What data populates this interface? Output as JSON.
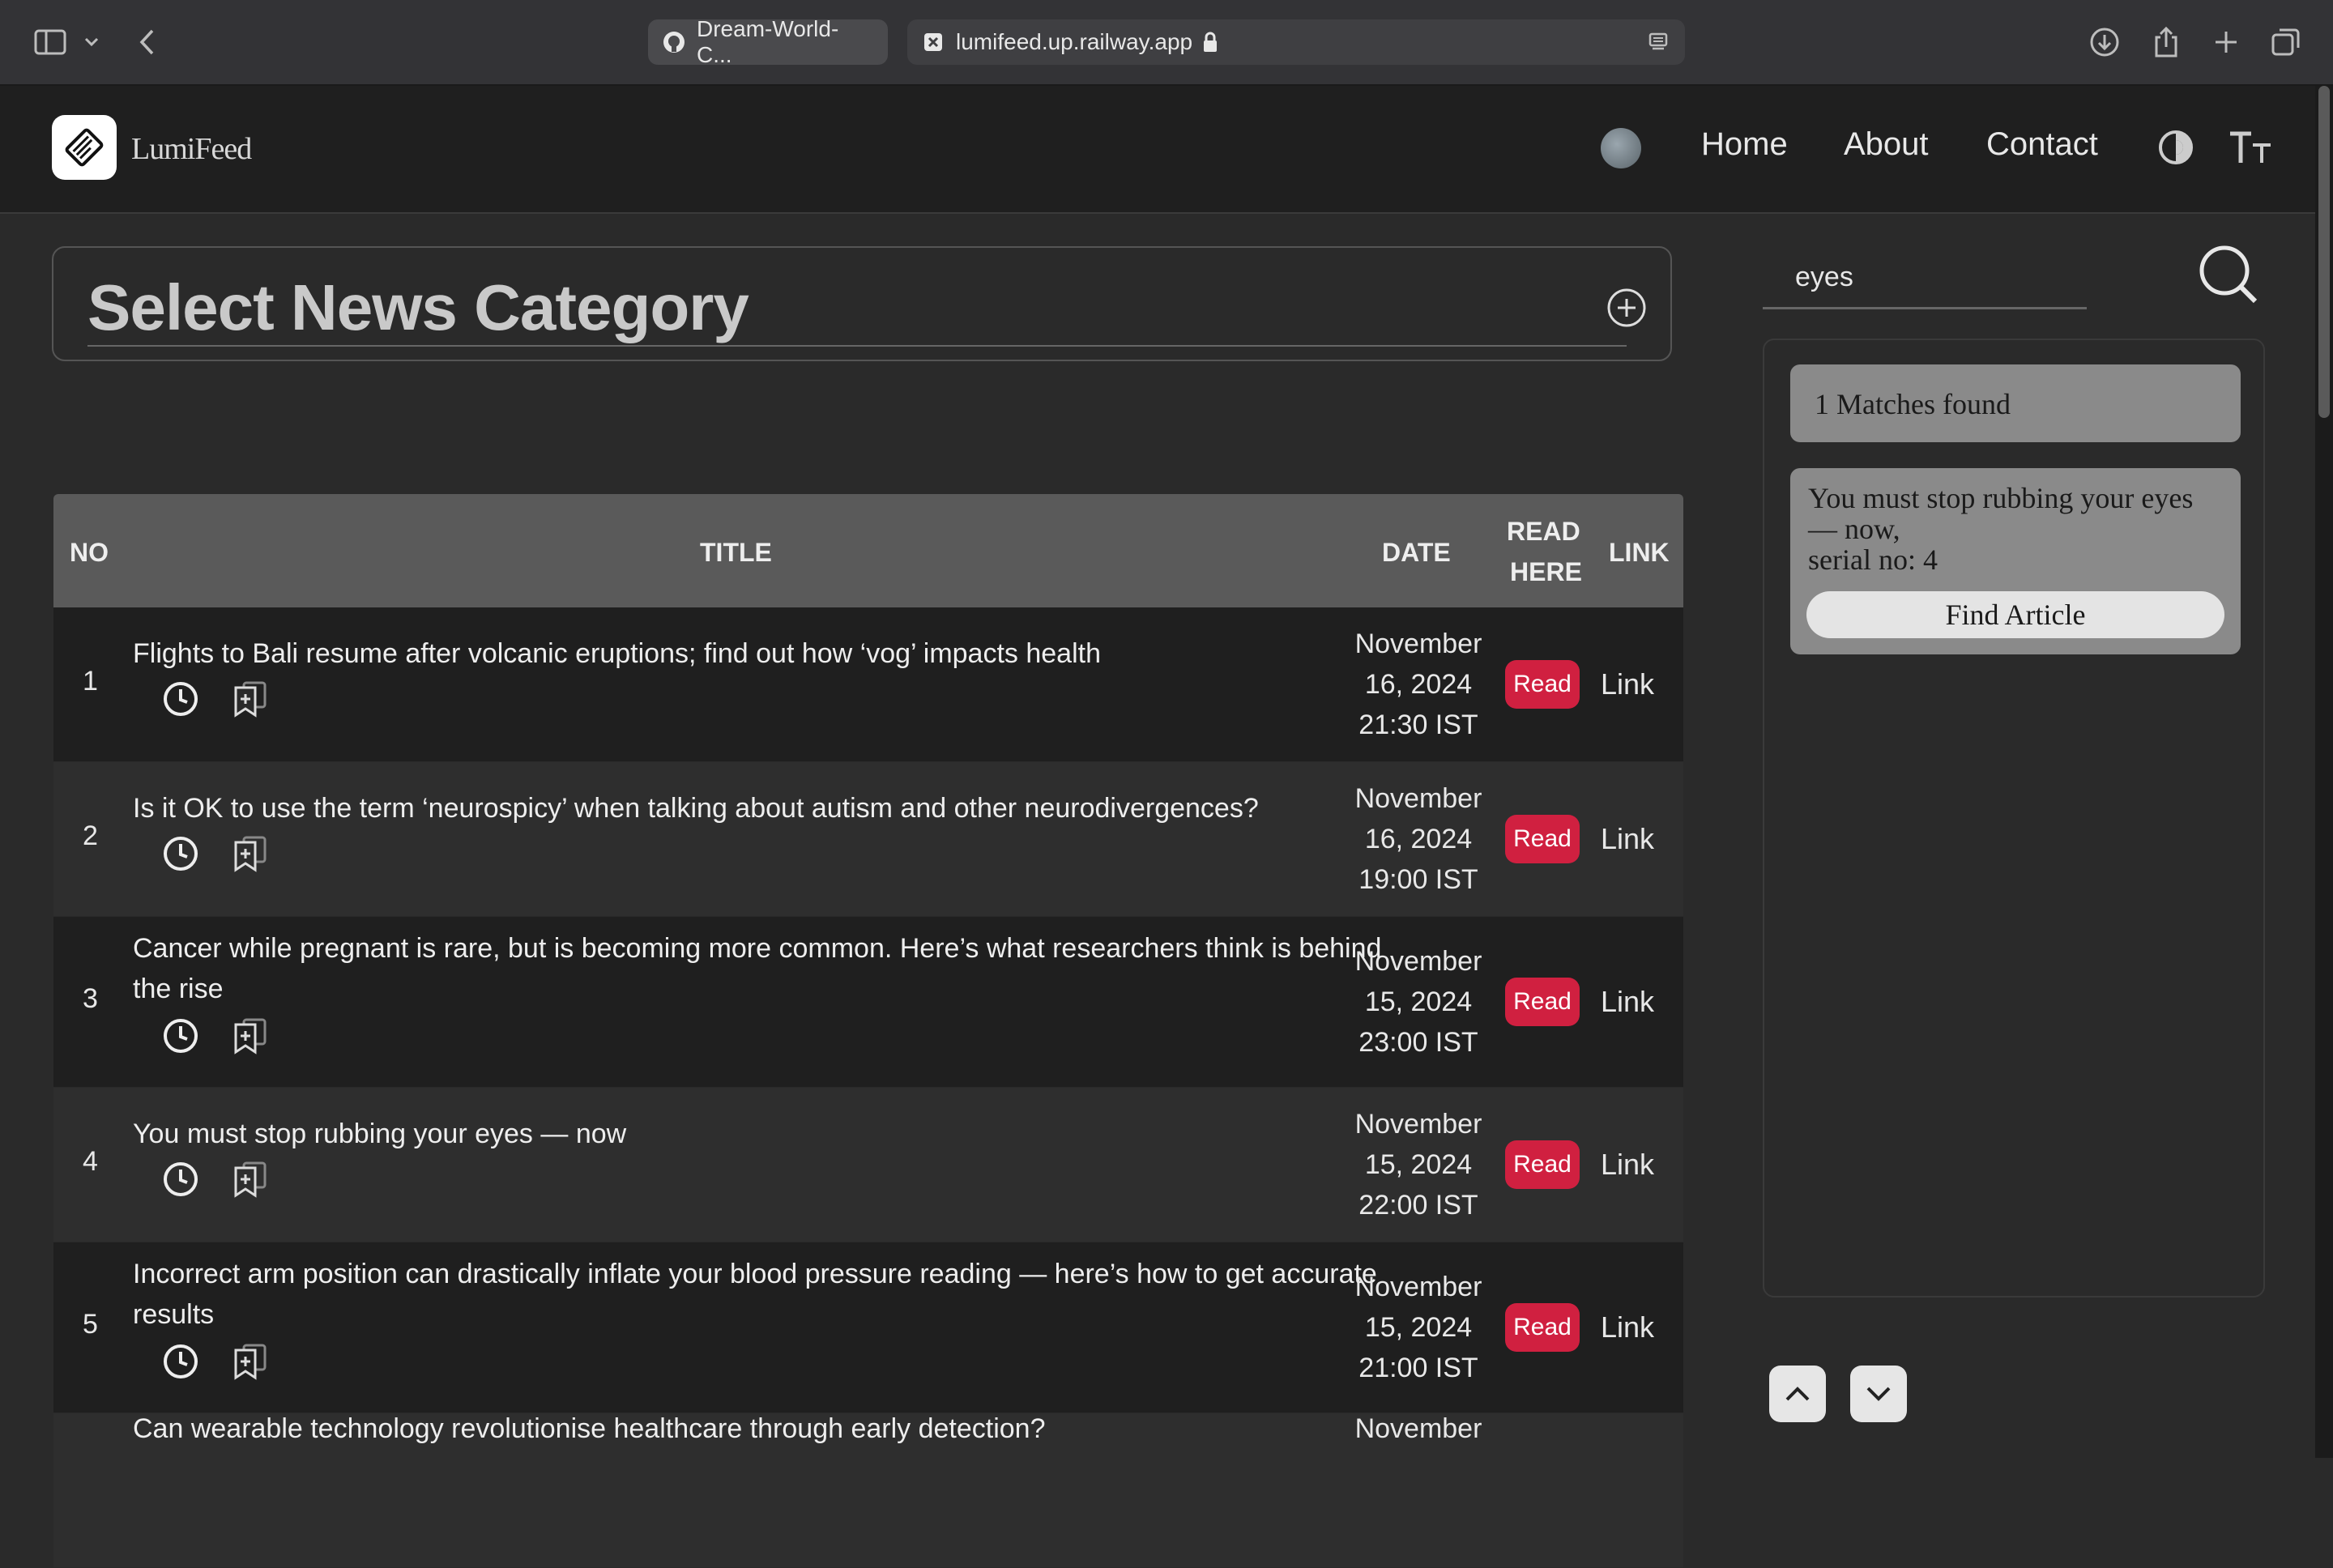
{
  "browser": {
    "tabs": [
      {
        "label": "Dream-World-C...",
        "icon": "github-icon"
      },
      {
        "label": "lumifeed.up.railway.app",
        "icon": "favicon-x-icon"
      }
    ]
  },
  "header": {
    "brand": "LumiFeed",
    "nav": [
      "Home",
      "About",
      "Contact"
    ]
  },
  "category": {
    "title": "Select News Category"
  },
  "table": {
    "columns": {
      "no": "NO",
      "title": "TITLE",
      "date": "DATE",
      "read_l1": "READ",
      "read_l2": "HERE",
      "link": "LINK"
    },
    "rows": [
      {
        "no": "1",
        "title": "Flights to Bali resume after volcanic eruptions; find out how ‘vog’ impacts health",
        "date_l1": "November",
        "date_l2": "16, 2024",
        "date_l3": "21:30 IST",
        "read": "Read",
        "link": "Link"
      },
      {
        "no": "2",
        "title": "Is it OK to use the term ‘neurospicy’ when talking about autism and other neurodivergences?",
        "date_l1": "November",
        "date_l2": "16, 2024",
        "date_l3": "19:00 IST",
        "read": "Read",
        "link": "Link"
      },
      {
        "no": "3",
        "title": "Cancer while pregnant is rare, but is becoming more common. Here’s what researchers think is behind the rise",
        "date_l1": "November",
        "date_l2": "15, 2024",
        "date_l3": "23:00 IST",
        "read": "Read",
        "link": "Link"
      },
      {
        "no": "4",
        "title": "You must stop rubbing your eyes — now",
        "date_l1": "November",
        "date_l2": "15, 2024",
        "date_l3": "22:00 IST",
        "read": "Read",
        "link": "Link"
      },
      {
        "no": "5",
        "title": "Incorrect arm position can drastically inflate your blood pressure reading — here’s how to get accurate results",
        "date_l1": "November",
        "date_l2": "15, 2024",
        "date_l3": "21:00 IST",
        "read": "Read",
        "link": "Link"
      },
      {
        "no": "",
        "title": "Can wearable technology revolutionise healthcare through early detection?",
        "date_l1": "November",
        "date_l2": "",
        "date_l3": "",
        "read": "",
        "link": ""
      }
    ]
  },
  "search": {
    "value": "eyes",
    "match_count": "1 Matches found",
    "result_title": "You must stop rubbing your eyes — now,",
    "result_serial": "serial no: 4",
    "find_label": "Find Article"
  },
  "colors": {
    "read_button": "#d02040",
    "header_bg": "#1f1f1f",
    "table_header": "#5a5a5a"
  }
}
